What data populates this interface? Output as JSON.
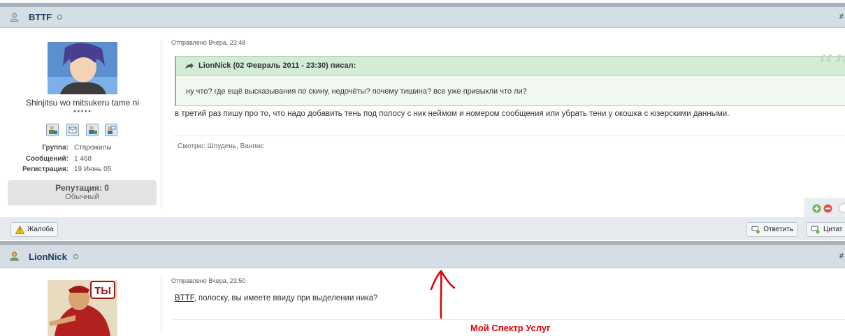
{
  "post1": {
    "username": "BTTF",
    "hash": "#",
    "user_title": "Shinjitsu wo mitsukeru tame ni",
    "pips": "●●●●●",
    "group_label": "Группа:",
    "group_value": "Старожилы",
    "posts_label": "Сообщений:",
    "posts_value": "1 468",
    "reg_label": "Регистрация:",
    "reg_value": "19 Июнь 05",
    "rep_title": "Репутация: 0",
    "rep_value": "Обычный",
    "posted": "Отправлено Вчера, 23:48",
    "quote_author": "LionNick (02 Февраль 2011 - 23:30) писал:",
    "quote_text": "ну что? где ещё высказывания по скину, недочёты? почему тишина? все уже привыкли что ли?",
    "body": "в третий раз пишу про то, что надо добавить тень под полосу с ник неймом и номером сообщения или убрать тени у окошка с юзерскими данными.",
    "viewers": "Смотрю: Шпудень, Ванпис",
    "report": "Жалоба",
    "reply": "Ответить",
    "quote_btn": "Цитат"
  },
  "post2": {
    "username": "LionNick",
    "hash": "#",
    "posted": "Отправлено Вчера, 23:50",
    "mention": "BTTF",
    "body_rest": ", полоску, вы имеете ввиду при выделении ника?",
    "avatar_text": "ТЫ"
  },
  "annotation": {
    "text": "Мой Спектр Услуг",
    "color": "#e00000"
  }
}
